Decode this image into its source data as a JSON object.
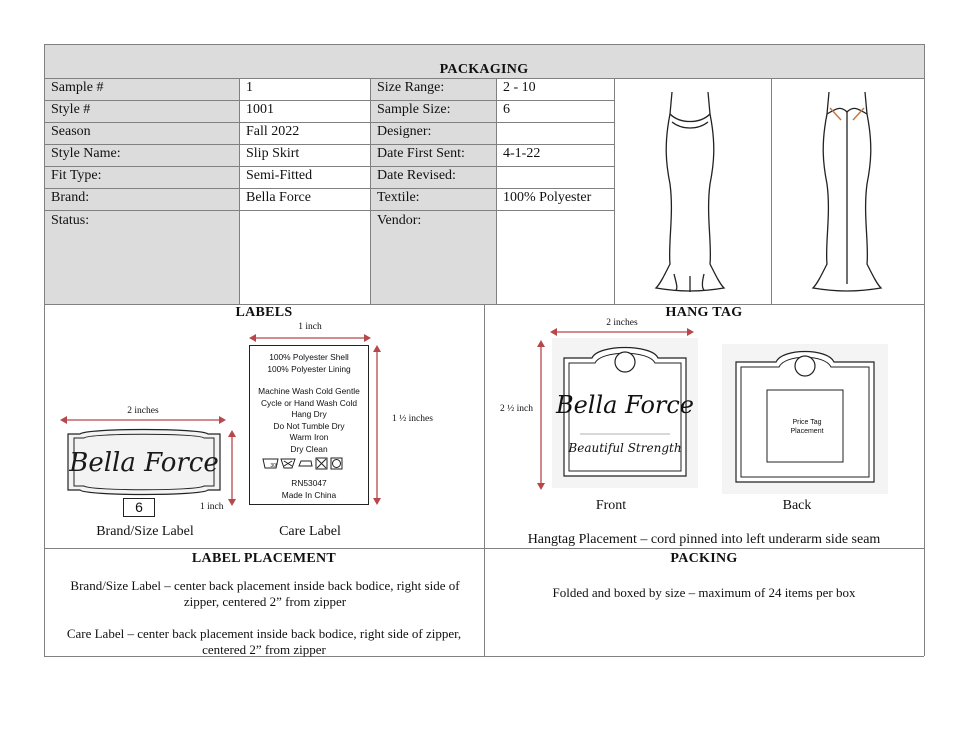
{
  "header": {
    "title": "PACKAGING"
  },
  "spec_rows": [
    {
      "l1": "Sample #",
      "v1": "1",
      "l2": "Size Range:",
      "v2": "2 - 10"
    },
    {
      "l1": "Style #",
      "v1": "1001",
      "l2": "Sample Size:",
      "v2": "6"
    },
    {
      "l1": "Season",
      "v1": "Fall 2022",
      "l2": "Designer:",
      "v2": ""
    },
    {
      "l1": "Style Name:",
      "v1": "Slip Skirt",
      "l2": "Date First Sent:",
      "v2": "4-1-22"
    },
    {
      "l1": "Fit Type:",
      "v1": "Semi-Fitted",
      "l2": "Date Revised:",
      "v2": ""
    },
    {
      "l1": "Brand:",
      "v1": "Bella Force",
      "l2": "Textile:",
      "v2": "100% Polyester"
    },
    {
      "l1": "Status:",
      "v1": "",
      "l2": "Vendor:",
      "v2": ""
    }
  ],
  "labels": {
    "title": "LABELS",
    "brand_label": {
      "width_dim": "2 inches",
      "height_dim": "1 inch",
      "logo_text": "Bella Force",
      "size": "6",
      "caption": "Brand/Size Label"
    },
    "care_label": {
      "width_dim": "1 inch",
      "height_dim": "1 ½ inches",
      "lines_top": [
        "100% Polyester Shell",
        "100% Polyester Lining"
      ],
      "lines_mid": [
        "Machine Wash Cold Gentle",
        "Cycle or Hand Wash Cold",
        "Hang Dry",
        "Do Not Tumble Dry",
        "Warm Iron",
        "Dry Clean"
      ],
      "care_symbols": "30°",
      "rn": "RN53047",
      "origin": "Made In China",
      "caption": "Care Label"
    }
  },
  "hang_tag": {
    "title": "HANG TAG",
    "width_dim": "2 inches",
    "height_dim": "2 ½ inch",
    "front_logo": "Bella Force",
    "front_tagline": "Beautiful Strength",
    "back_text": "Price Tag Placement",
    "front_caption": "Front",
    "back_caption": "Back",
    "placement_note": "Hangtag Placement – cord pinned into left underarm side seam"
  },
  "label_placement": {
    "title": "LABEL PLACEMENT",
    "para1": "Brand/Size Label – center back placement inside back bodice, right side of zipper, centered 2” from zipper",
    "para2": "Care Label – center back placement inside back bodice, right side of zipper, centered 2” from zipper"
  },
  "packing": {
    "title": "PACKING",
    "text": "Folded and boxed by size – maximum of 24 items per box"
  },
  "colors": {
    "grey_fill": "#dcdcdc",
    "border": "#808080",
    "dimension_red": "#b8474b"
  }
}
